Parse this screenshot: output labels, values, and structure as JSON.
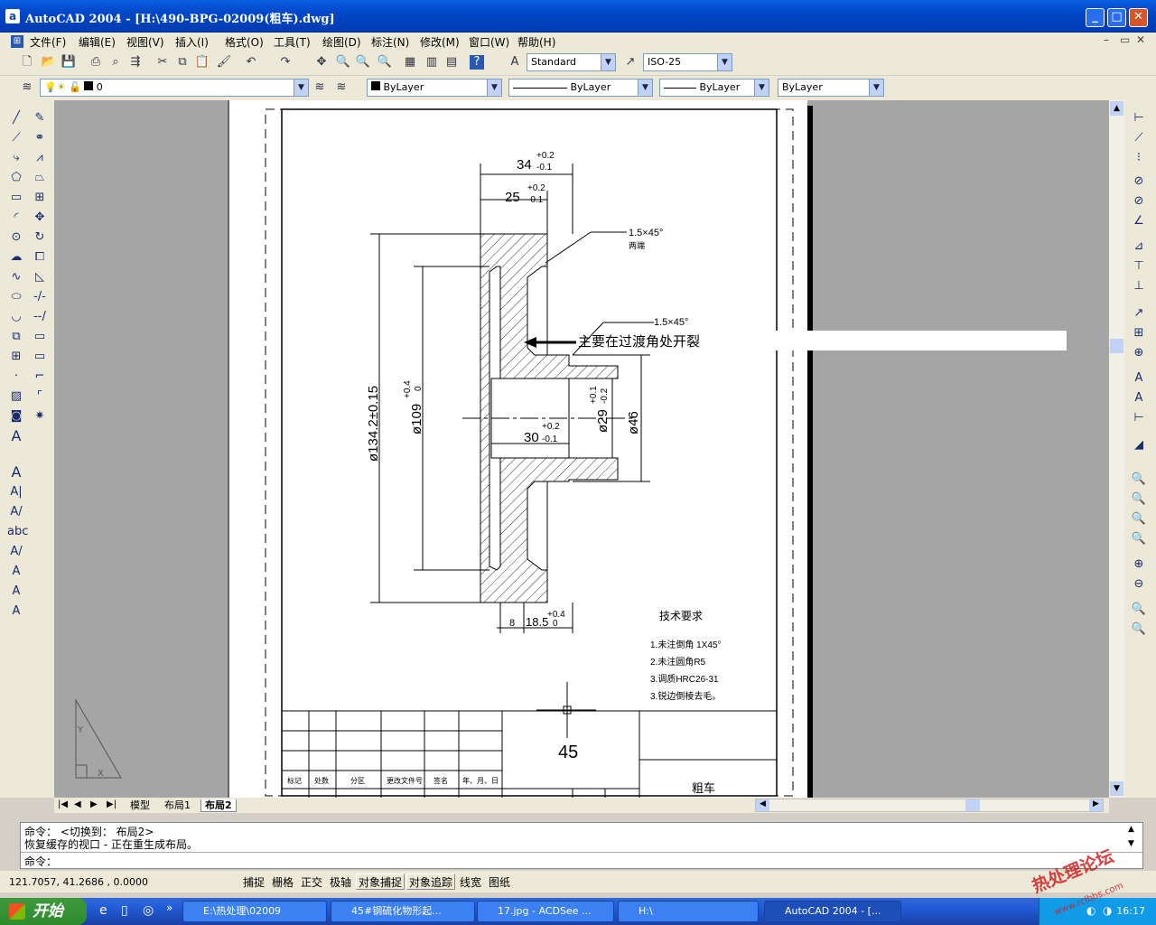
{
  "window": {
    "title": "AutoCAD 2004 - [H:\\490-BPG-02009(粗车).dwg]"
  },
  "menu": [
    "文件(F)",
    "编辑(E)",
    "视图(V)",
    "插入(I)",
    "格式(O)",
    "工具(T)",
    "绘图(D)",
    "标注(N)",
    "修改(M)",
    "窗口(W)",
    "帮助(H)"
  ],
  "toolbar": {
    "text_style": "Standard",
    "dim_style": "ISO-25",
    "layer": "0",
    "color": "ByLayer",
    "linetype": "ByLayer",
    "lineweight": "ByLayer",
    "plotstyle": "ByLayer"
  },
  "drawing": {
    "dim_34": "34",
    "tol_34_up": "+0.2",
    "tol_34_dn": "-0.1",
    "dim_25": "25",
    "tol_25_up": "+0.2",
    "tol_25_dn": "-0.1",
    "chamfer_1": "1.5×45°",
    "chamfer_1_note": "两端",
    "chamfer_2": "1.5×45°",
    "annotation": "主要在过渡角处开裂",
    "dim_134": "ø134.2±0.15",
    "dim_109": "ø109",
    "tol_109_up": "+0.4",
    "tol_109_dn": "0",
    "dim_29": "ø29",
    "tol_29_up": "+0.1",
    "tol_29_dn": "-0.2",
    "dim_46": "ø46",
    "dim_30": "30",
    "tol_30_up": "+0.2",
    "tol_30_dn": "-0.1",
    "dim_8": "8",
    "dim_18": "18.5",
    "tol_18_up": "+0.4",
    "tol_18_dn": "0",
    "tech_title": "技术要求",
    "tech_1": "1.未注倒角 1X45°",
    "tech_2": "2.未注圆角R5",
    "tech_3": "3.调质HRC26-31",
    "tech_4": "3.锐边倒棱去毛。",
    "material": "45",
    "part_name": "粗车",
    "tb_headers": [
      "标记",
      "处数",
      "分区",
      "更改文件号",
      "签名",
      "年、月、日"
    ]
  },
  "layout_tabs": [
    "模型",
    "布局1",
    "布局2"
  ],
  "command": {
    "line1": "命令： <切换到： 布局2>",
    "line2": "恢复缓存的视口 - 正在重生成布局。",
    "line3": "命令："
  },
  "status": {
    "coords": "121.7057, 41.2686 , 0.0000",
    "buttons": [
      "捕捉",
      "栅格",
      "正交",
      "极轴",
      "对象捕捉",
      "对象追踪",
      "线宽",
      "图纸"
    ]
  },
  "taskbar": {
    "start": "开始",
    "items": [
      "E:\\热处理\\02009",
      "45#钢硫化物形起...",
      "17.jpg - ACDSee ...",
      "H:\\",
      "AutoCAD 2004 - [..."
    ],
    "clock": "16:17"
  },
  "watermark": {
    "text": "热处理论坛",
    "url": "www.rclbbs.com"
  }
}
